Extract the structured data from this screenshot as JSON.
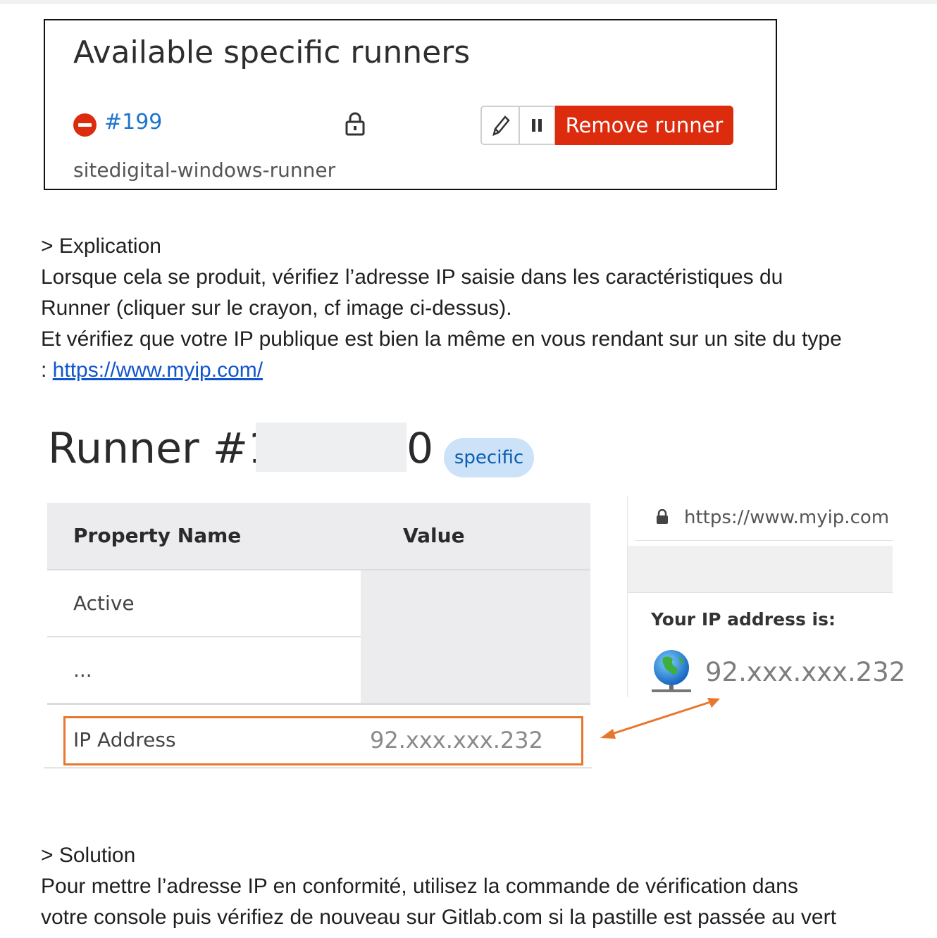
{
  "runners_card": {
    "title": "Available specific runners",
    "runner_id": "#199",
    "runner_description": "sitedigital-windows-runner",
    "remove_label": "Remove runner",
    "status_icon": "stop-circle-icon",
    "colors": {
      "danger": "#dd2b0e",
      "link": "#1f75cb"
    }
  },
  "explication": {
    "heading": "> Explication",
    "line1": "Lorsque cela se produit, vérifiez l’adresse IP saisie dans les caractéristiques du",
    "line2": "Runner (cliquer sur le crayon, cf image ci-dessus).",
    "line3": "Et vérifiez que votre IP publique est bien la même en vous rendant sur un site du type",
    "line4_prefix": ": ",
    "link": "https://www.myip.com/"
  },
  "runner_detail": {
    "title_start": "Runner #1",
    "title_end": "0",
    "badge": "specific",
    "table_headers": {
      "property": "Property Name",
      "value": "Value"
    },
    "rows": [
      "Active",
      "..."
    ],
    "ip_label": "IP Address",
    "ip_value": "92.xxx.xxx.232",
    "highlight_color": "#e8772e"
  },
  "myip_panel": {
    "url": "https://www.myip.com",
    "label": "Your IP address is:",
    "ip": "92.xxx.xxx.232"
  },
  "solution": {
    "heading": "> Solution",
    "line1": "Pour mettre l’adresse IP en conformité, utilisez la commande de vérification dans",
    "line2": "votre console puis vérifiez de nouveau sur Gitlab.com si la pastille est passée au vert"
  }
}
